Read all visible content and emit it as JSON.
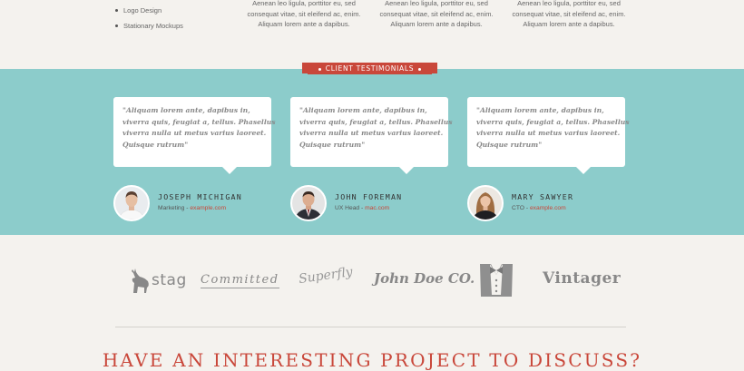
{
  "services": {
    "items": [
      "Logo Design",
      "Stationary Mockups"
    ]
  },
  "snippets": [
    {
      "lines": [
        "Aenean leo ligula, porttitor eu, sed",
        "consequat vitae, sit eleifend ac, enim.",
        "Aliquam lorem ante a dapibus."
      ]
    },
    {
      "lines": [
        "Aenean leo ligula, porttitor eu, sed",
        "consequat vitae, sit eleifend ac, enim.",
        "Aliquam lorem ante a dapibus."
      ]
    },
    {
      "lines": [
        "Aenean leo ligula, porttitor eu, sed",
        "consequat vitae, sit eleifend ac, enim.",
        "Aliquam lorem ante a dapibus."
      ]
    }
  ],
  "testimonials": {
    "heading": "CLIENT TESTIMONIALS",
    "accent_color": "#c9473a",
    "band_color": "#8ccccb",
    "items": [
      {
        "quote": [
          "\"Aliquam lorem ante, dapibus in,",
          "viverra quis, feugiat a, tellus. Phasellus",
          "viverra nulla ut metus varius laoreet.",
          "Quisque rutrum\""
        ],
        "name": "JOSEPH MICHIGAN",
        "role": "Marketing - ",
        "site": "example.com"
      },
      {
        "quote": [
          "\"Aliquam lorem ante, dapibus in,",
          "viverra quis, feugiat a, tellus. Phasellus",
          "viverra nulla ut metus varius laoreet.",
          "Quisque rutrum\""
        ],
        "name": "JOHN FOREMAN",
        "role": "UX Head - ",
        "site": "mac.com"
      },
      {
        "quote": [
          "\"Aliquam lorem ante, dapibus in,",
          "viverra quis, feugiat a, tellus. Phasellus",
          "viverra nulla ut metus varius laoreet.",
          "Quisque rutrum\""
        ],
        "name": "MARY SAWYER",
        "role": "CTO - ",
        "site": "example.com"
      }
    ]
  },
  "clients": {
    "logos": [
      "stag",
      "Committed",
      "Superfly",
      "John Doe CO.",
      "tuxedo-icon",
      "Vintager"
    ]
  },
  "cta": {
    "text": "HAVE AN INTERESTING PROJECT TO DISCUSS?"
  }
}
